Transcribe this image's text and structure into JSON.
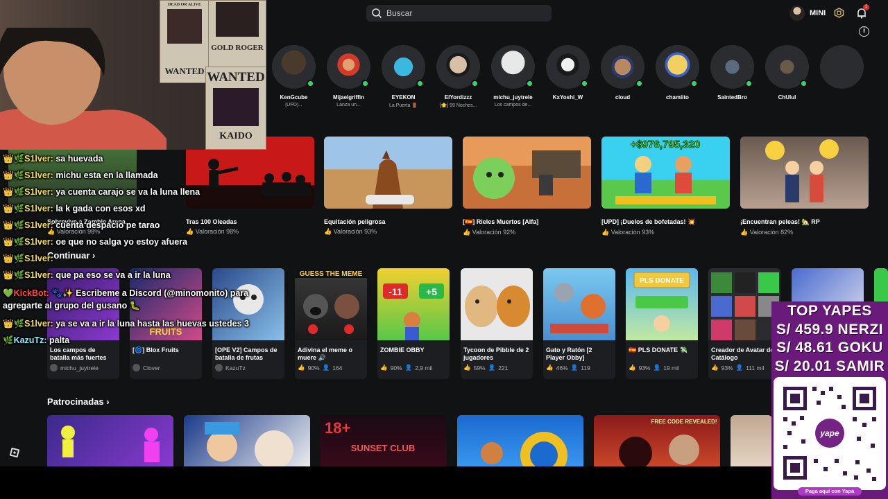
{
  "search": {
    "placeholder": "Buscar"
  },
  "user": {
    "name": "MINI"
  },
  "notifications": {
    "count": "1"
  },
  "friends": [
    {
      "name": "KenGcube",
      "status": "[UPD]..."
    },
    {
      "name": "Mijaelgriffin",
      "status": "Lanza un..."
    },
    {
      "name": "EYEKON",
      "status": "La Puerta 🚪"
    },
    {
      "name": "ElYordizzz",
      "status": "[🌟] 99 Noches..."
    },
    {
      "name": "michu_juytrele",
      "status": "Los campos de..."
    },
    {
      "name": "KxYoshi_W",
      "status": ""
    },
    {
      "name": "cloud",
      "status": ""
    },
    {
      "name": "chamiito",
      "status": ""
    },
    {
      "name": "SaintedBro",
      "status": ""
    },
    {
      "name": "ChUlul",
      "status": ""
    },
    {
      "name": "",
      "status": ""
    }
  ],
  "top_games": [
    {
      "title": "Sobrevive a Zombie Arena",
      "rating": "Valoración 98%"
    },
    {
      "title": "Tras 100 Oleadas",
      "rating": "Valoración 98%"
    },
    {
      "title": "Equitación peligrosa",
      "rating": "Valoración 93%"
    },
    {
      "title": "[🇪🇸] Rieles Muertos [Alfa]",
      "rating": "Valoración 92%"
    },
    {
      "title": "[UPD] ¡Duelos de bofetadas! 💥",
      "rating": "Valoración 93%"
    },
    {
      "title": "¡Encuentran peleas! 🏡 RP",
      "rating": "Valoración 82%"
    }
  ],
  "continue": {
    "title": "Continuar",
    "items": [
      {
        "title": "Los campos de batalla más fuertes",
        "creator": "michu_juytrele",
        "rating": "",
        "players": ""
      },
      {
        "title": "[🌀] Blox Fruits",
        "creator": "Clover",
        "rating": "",
        "players": ""
      },
      {
        "title": "[OPE V2] Campos de batalla de frutas",
        "creator": "KazuTz",
        "rating": "",
        "players": ""
      },
      {
        "title": "Adivina el meme o muere 🔊",
        "creator": "",
        "rating": "90%",
        "players": "164"
      },
      {
        "title": "ZOMBIE OBBY",
        "creator": "",
        "rating": "90%",
        "players": "2,9 mil"
      },
      {
        "title": "Tycoon de Pibble de 2 jugadores",
        "creator": "",
        "rating": "59%",
        "players": "221"
      },
      {
        "title": "Gato y Ratón [2 Player Obby]",
        "creator": "",
        "rating": "46%",
        "players": "119"
      },
      {
        "title": "🇪🇸 PLS DONATE 💸",
        "creator": "",
        "rating": "93%",
        "players": "19 mil"
      },
      {
        "title": "Creador de Avatar de Catálogo",
        "creator": "",
        "rating": "93%",
        "players": "111 mil"
      }
    ],
    "thumb_labels": {
      "meme": "GUESS THE MEME",
      "minus": "-11",
      "plus": "+5",
      "donate": "PLS DONATE",
      "blox": "FRUITS"
    }
  },
  "sponsored": {
    "title": "Patrocinadas",
    "thumb_labels": {
      "age": "18+",
      "club": "SUNSET CLUB",
      "code": "FREE CODE REVEALED!"
    }
  },
  "chat": [
    {
      "badge": "👑🌿",
      "user": "S1lver:",
      "msg": "sa huevada",
      "type": "sub"
    },
    {
      "badge": "👑🌿",
      "user": "S1lver:",
      "msg": "michu esta en la llamada",
      "type": "sub"
    },
    {
      "badge": "👑🌿",
      "user": "S1lver:",
      "msg": "ya cuenta carajo se va la luna llena",
      "type": "sub"
    },
    {
      "badge": "👑🌿",
      "user": "S1lver:",
      "msg": "la k gada con esos xd",
      "type": "sub"
    },
    {
      "badge": "👑🌿",
      "user": "S1lver:",
      "msg": "cuenta despacio pe tarao",
      "type": "sub"
    },
    {
      "badge": "👑🌿",
      "user": "S1lver:",
      "msg": "oe que no salga yo estoy afuera",
      "type": "sub"
    },
    {
      "badge": "👑🌿",
      "user": "S1lver:",
      "msg": "",
      "type": "sub"
    },
    {
      "badge": "👑🌿",
      "user": "S1lver:",
      "msg": "que pa eso se va a ir la luna",
      "type": "sub"
    },
    {
      "badge": "💚",
      "user": "KickBot:",
      "msg": "🐾✨ Escribeme a Discord (@minomonito) para",
      "type": "bot"
    },
    {
      "badge": "",
      "user": "",
      "msg": "agregarte al grupo del gusano 🐛",
      "type": "cont"
    },
    {
      "badge": "👑🌿",
      "user": "S1lver:",
      "msg": "ya se va a ir la luna hasta las huevas ustedes 3",
      "type": "sub"
    },
    {
      "badge": "🌿",
      "user": "KazuTz:",
      "msg": "palta",
      "type": "kaz"
    }
  ],
  "donations": {
    "title": "TOP YAPES",
    "lines": [
      "S/ 459.9 NERZI",
      "S/ 48.61 GOKU",
      "S/ 20.01 SAMIR"
    ],
    "brand": "yape",
    "pay_label": "Paga aquí con Yapa"
  },
  "webcam": {
    "poster1": "WANTED",
    "poster2": "WANTED",
    "poster_name": "GOLD ROGER",
    "poster_kaido": "KAIDO",
    "poster_bounty": "DEAD OR ALIVE"
  }
}
